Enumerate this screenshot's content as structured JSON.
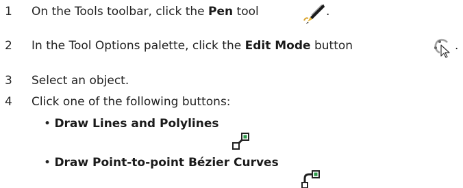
{
  "steps": [
    {
      "number": "1",
      "before": "On the Tools toolbar, click the ",
      "bold": "Pen",
      "after": " tool",
      "end": ".",
      "icon": "pen-tool-icon"
    },
    {
      "number": "2",
      "before": "In the Tool Options palette, click the ",
      "bold": "Edit Mode",
      "after": " button",
      "end": ".",
      "icon": "edit-mode-icon"
    },
    {
      "number": "3",
      "text": "Select an object."
    },
    {
      "number": "4",
      "text": "Click one of the following buttons:",
      "bullets": [
        {
          "bullet": "•",
          "label": "Draw Lines and Polylines",
          "icon": "draw-lines-polylines-icon"
        },
        {
          "bullet": "•",
          "label": "Draw Point-to-point Bézier Curves",
          "icon": "draw-bezier-curves-icon"
        }
      ]
    }
  ],
  "colors": {
    "text": "#222222",
    "icon_green": "#2e9a4a",
    "icon_dark": "#222222"
  }
}
